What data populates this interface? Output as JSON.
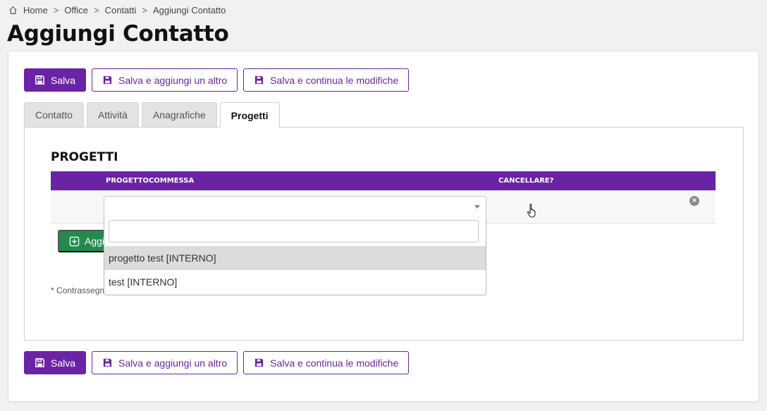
{
  "breadcrumb": {
    "items": [
      "Home",
      "Office",
      "Contatti",
      "Aggiungi Contatto"
    ],
    "separator": ">"
  },
  "page": {
    "title": "Aggiungi Contatto"
  },
  "actions": {
    "save": "Salva",
    "save_add_another": "Salva e aggiungi un altro",
    "save_continue": "Salva e continua le modifiche"
  },
  "tabs": [
    {
      "label": "Contatto",
      "active": false
    },
    {
      "label": "Attività",
      "active": false
    },
    {
      "label": "Anagrafiche",
      "active": false
    },
    {
      "label": "Progetti",
      "active": true
    }
  ],
  "section": {
    "title": "PROGETTI",
    "columns": {
      "project": "PROGETTOCOMMESSA",
      "delete": "CANCELLARE?"
    }
  },
  "inline_row": {
    "project_value": "",
    "remove_icon": "close-circle-icon"
  },
  "add_button": {
    "label": "Aggi",
    "icon": "plus-square-icon"
  },
  "footnote": "* Contrassegn",
  "dropdown": {
    "search_value": "",
    "options": [
      {
        "label": "progetto test [INTERNO]",
        "highlighted": true
      },
      {
        "label": "test [INTERNO]",
        "highlighted": false
      }
    ]
  },
  "colors": {
    "primary": "#6b23a5",
    "success": "#238a4e",
    "page_background": "#f1f1f3",
    "option_highlight": "#dcdcdc"
  },
  "icons": {
    "home": "home-icon",
    "save": "floppy-disk-icon",
    "cursor": "hand-pointer-icon",
    "dropdown": "chevron-down-icon"
  }
}
